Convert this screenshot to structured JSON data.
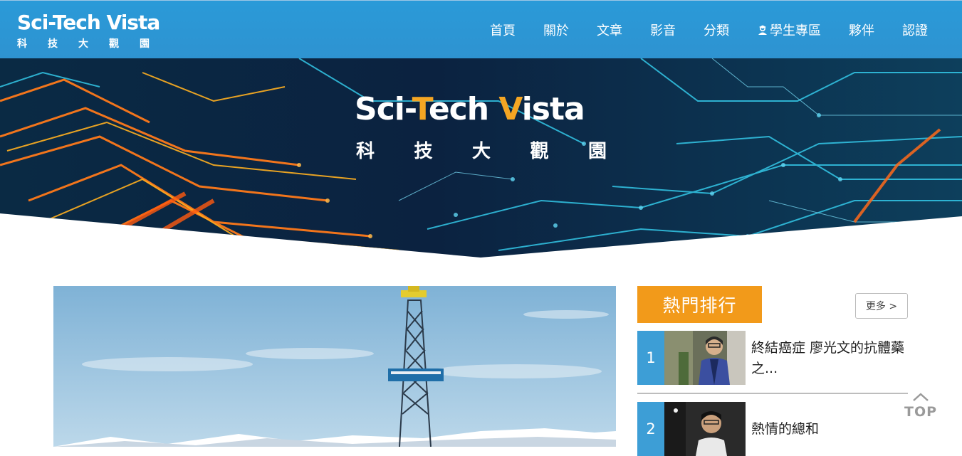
{
  "brand": {
    "name_en": "Sci-Tech Vista",
    "name_zh": [
      "科",
      "技",
      "大",
      "觀",
      "園"
    ]
  },
  "nav": {
    "items": [
      {
        "label": "首頁"
      },
      {
        "label": "關於"
      },
      {
        "label": "文章"
      },
      {
        "label": "影音"
      },
      {
        "label": "分類"
      },
      {
        "label": "學生專區",
        "icon": "student-icon"
      },
      {
        "label": "夥伴"
      },
      {
        "label": "認證"
      }
    ]
  },
  "hero": {
    "title_en_parts": [
      "Sci-",
      "T",
      "ech ",
      "V",
      "ista"
    ],
    "title_zh": [
      "科",
      "技",
      "大",
      "觀",
      "園"
    ]
  },
  "ranking": {
    "title": "熱門排行",
    "more_label": "更多 >",
    "items": [
      {
        "rank": "1",
        "title": "終結癌症 廖光文的抗體藥之..."
      },
      {
        "rank": "2",
        "title": "熱情的總和"
      }
    ]
  },
  "back_to_top": {
    "label": "TOP",
    "icon": "chevron-up-icon"
  },
  "colors": {
    "nav_bg": "#2e93d1",
    "accent_orange": "#f29a1a",
    "rank_blue": "#3d9ed6"
  }
}
